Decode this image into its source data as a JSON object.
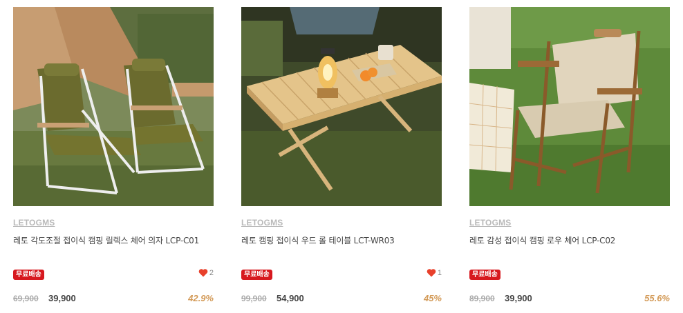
{
  "products": [
    {
      "brand": "LETOGMS",
      "title": "레토 각도조절 접이식 캠핑 릴렉스 체어 의자 LCP-C01",
      "badge": "무료배송",
      "likes": "2",
      "original_price": "69,900",
      "sale_price": "39,900",
      "discount": "42.9%",
      "image_icon": "folding-relax-chair-photo"
    },
    {
      "brand": "LETOGMS",
      "title": "레토 캠핑 접이식 우드 롤 테이블 LCT-WR03",
      "badge": "무료배송",
      "likes": "1",
      "original_price": "99,900",
      "sale_price": "54,900",
      "discount": "45%",
      "image_icon": "wood-roll-table-photo"
    },
    {
      "brand": "LETOGMS",
      "title": "레토 감성 접이식 캠핑 로우 체어 LCP-C02",
      "badge": "무료배송",
      "likes": "",
      "original_price": "89,900",
      "sale_price": "39,900",
      "discount": "55.6%",
      "image_icon": "low-chair-photo"
    }
  ],
  "colors": {
    "badge_bg": "#d7191f",
    "heart": "#e8402b",
    "discount": "#d39a57",
    "brand": "#b9b9b9"
  }
}
